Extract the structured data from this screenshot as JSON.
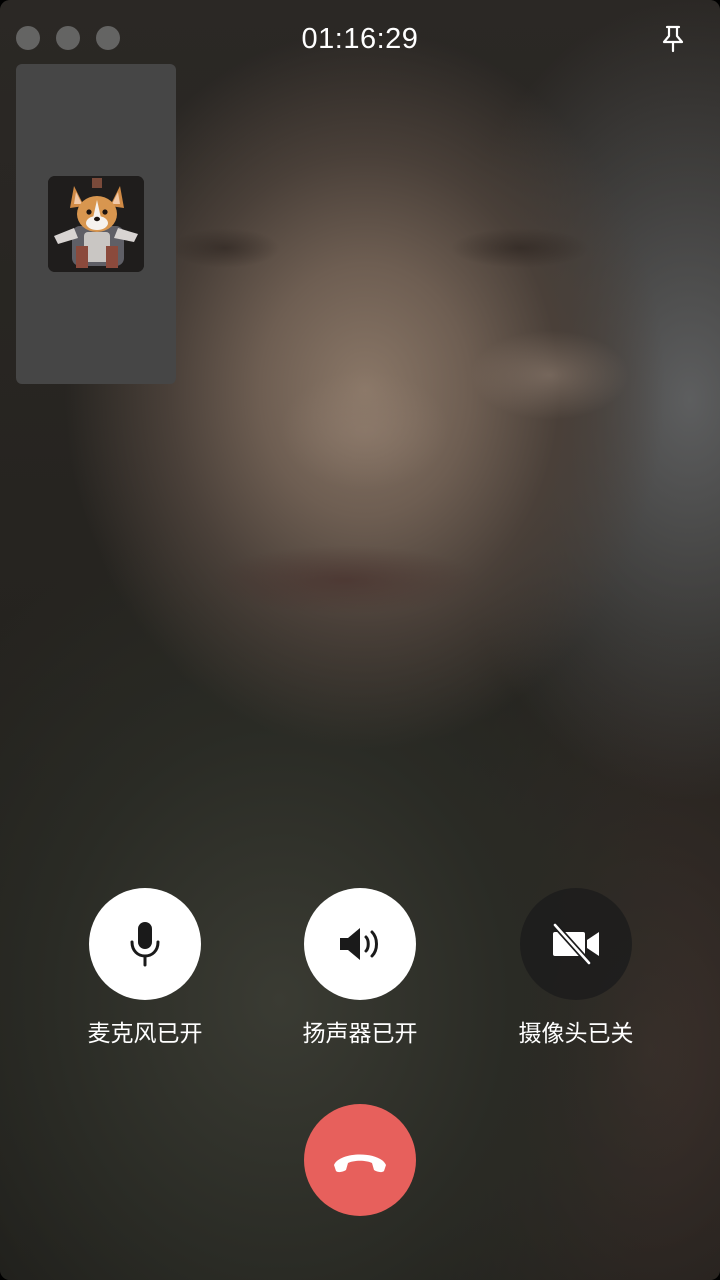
{
  "window": {
    "traffic_lights": [
      "close",
      "minimize",
      "zoom"
    ]
  },
  "header": {
    "call_timer": "01:16:29",
    "pin_icon": "pin-icon"
  },
  "self_preview": {
    "avatar_icon": "corgi-avatar"
  },
  "controls": {
    "microphone": {
      "label": "麦克风已开",
      "state": "on",
      "icon": "microphone-icon"
    },
    "speaker": {
      "label": "扬声器已开",
      "state": "on",
      "icon": "speaker-icon"
    },
    "camera": {
      "label": "摄像头已关",
      "state": "off",
      "icon": "camera-off-icon"
    },
    "hangup": {
      "icon": "hangup-icon"
    }
  },
  "colors": {
    "hangup": "#e7605c",
    "active_control": "#ffffff",
    "inactive_control": "#1c1c1c",
    "text": "#ffffff",
    "self_preview_bg": "#464646"
  }
}
